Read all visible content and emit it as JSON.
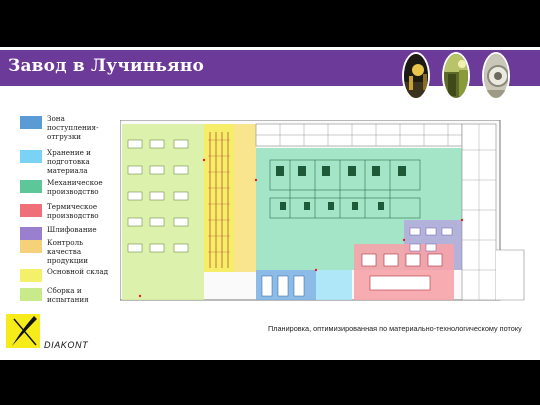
{
  "header": {
    "title": "Завод в Лучиньяно"
  },
  "legend": {
    "items": [
      {
        "label": "Зона поступления-отгрузки",
        "color": "#5b9bd5"
      },
      {
        "label": "Хранение и подготовка материала",
        "color": "#7ad3f5"
      },
      {
        "label": "Механическое производство",
        "color": "#5ec79a"
      },
      {
        "label": "Термическое производство",
        "color": "#f0707a"
      },
      {
        "label": "Шлифование",
        "color": "#9a7fcf"
      },
      {
        "label": "Контроль качества продукции",
        "color": "#f5d27a"
      },
      {
        "label": "Основной склад",
        "color": "#f5f06a"
      },
      {
        "label": "Сборка и испытания",
        "color": "#c9ea8a"
      }
    ]
  },
  "plan": {
    "caption": "Планировка, оптимизированная по материально-технологическому потоку"
  },
  "logo": {
    "name": "DIAKONT"
  },
  "colors": {
    "banner": "#6c3a99",
    "accent": "#f7ec1a"
  }
}
